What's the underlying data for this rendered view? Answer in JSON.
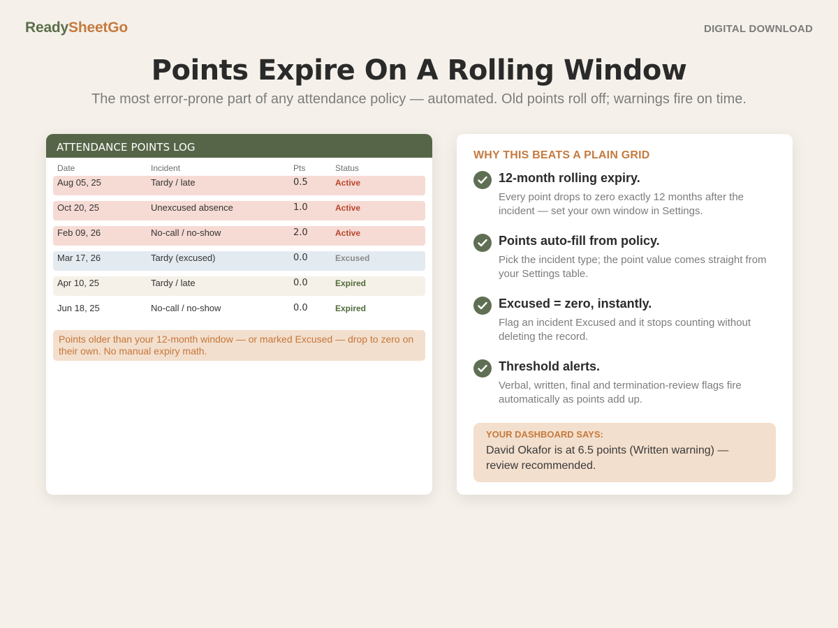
{
  "brand": {
    "part1": "Ready",
    "part2": "SheetGo"
  },
  "tag": "DIGITAL DOWNLOAD",
  "headline": "Points Expire On A Rolling Window",
  "subhead": "The most error-prone part of any attendance policy — automated. Old points roll off; warnings fire on time.",
  "log": {
    "title": "ATTENDANCE POINTS LOG",
    "columns": [
      "Date",
      "Incident",
      "Pts",
      "Status"
    ],
    "rows": [
      {
        "date": "Aug 05, 25",
        "incident": "Tardy / late",
        "pts": "0.5",
        "status": "Active",
        "bg": "#f6dbd4",
        "status_color": "#b8452e"
      },
      {
        "date": "Oct 20, 25",
        "incident": "Unexcused absence",
        "pts": "1.0",
        "status": "Active",
        "bg": "#f6dbd4",
        "status_color": "#b8452e"
      },
      {
        "date": "Feb 09, 26",
        "incident": "No-call / no-show",
        "pts": "2.0",
        "status": "Active",
        "bg": "#f6dbd4",
        "status_color": "#b8452e"
      },
      {
        "date": "Mar 17, 26",
        "incident": "Tardy (excused)",
        "pts": "0.0",
        "status": "Excused",
        "bg": "#e3ebf1",
        "status_color": "#8a8a8a"
      },
      {
        "date": "Apr 10, 25",
        "incident": "Tardy / late",
        "pts": "0.0",
        "status": "Expired",
        "bg": "#f6f1e8",
        "status_color": "#4f6b3a"
      },
      {
        "date": "Jun 18, 25",
        "incident": "No-call / no-show",
        "pts": "0.0",
        "status": "Expired",
        "bg": "#ffffff",
        "status_color": "#4f6b3a"
      }
    ],
    "note": "Points older than your 12-month window — or marked Excused — drop to zero on their own. No manual expiry math."
  },
  "why": {
    "title": "WHY THIS BEATS A PLAIN GRID",
    "features": [
      {
        "icon": "check-circle-icon",
        "title": "12-month rolling expiry.",
        "desc": "Every point drops to zero exactly 12 months after the incident — set your own window in Settings."
      },
      {
        "icon": "check-circle-icon",
        "title": "Points auto-fill from policy.",
        "desc": "Pick the incident type; the point value comes straight from your Settings table."
      },
      {
        "icon": "check-circle-icon",
        "title": "Excused = zero, instantly.",
        "desc": "Flag an incident Excused and it stops counting without deleting the record."
      },
      {
        "icon": "check-circle-icon",
        "title": "Threshold alerts.",
        "desc": "Verbal, written, final and termination-review flags fire automatically as points add up."
      }
    ],
    "dashboard": {
      "label": "YOUR DASHBOARD SAYS:",
      "text": "David Okafor is at 6.5 points (Written warning) — review recommended."
    }
  }
}
